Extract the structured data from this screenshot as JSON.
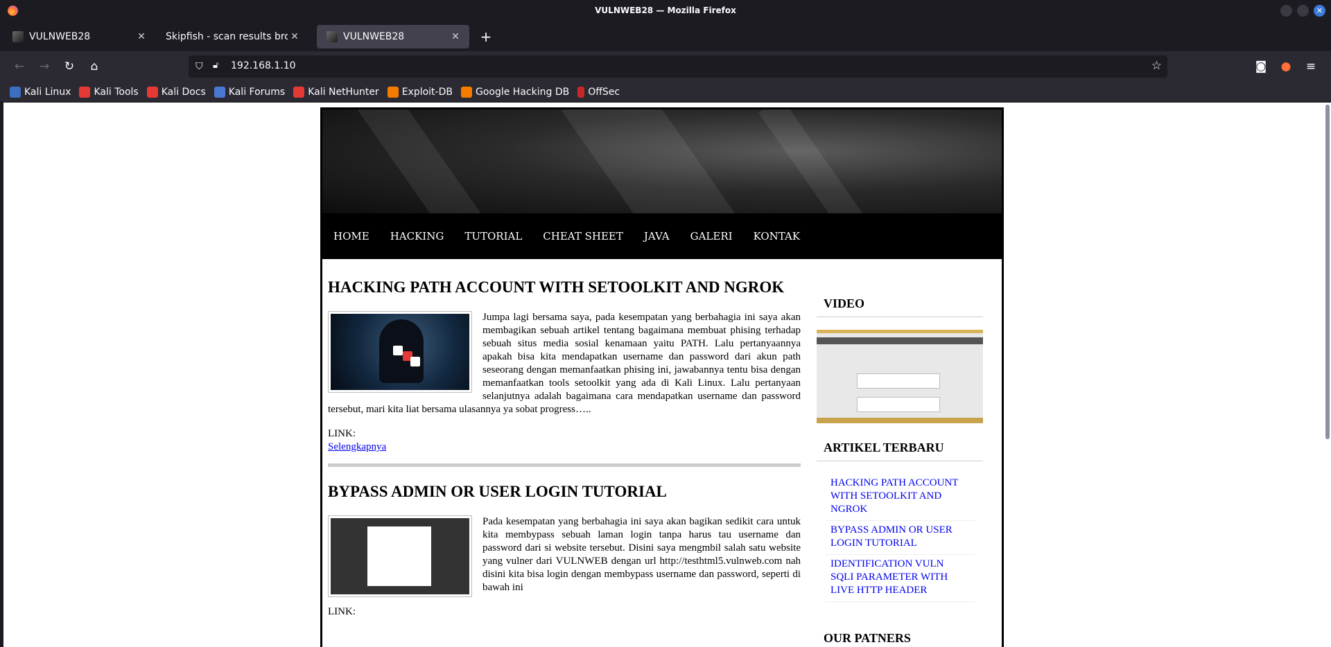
{
  "window": {
    "title": "VULNWEB28 — Mozilla Firefox"
  },
  "tabs": [
    {
      "label": "VULNWEB28",
      "active": false
    },
    {
      "label": "Skipfish - scan results browse",
      "active": false
    },
    {
      "label": "VULNWEB28",
      "active": true
    }
  ],
  "navbar": {
    "url": "192.168.1.10"
  },
  "bookmarks": [
    {
      "label": "Kali Linux",
      "icon": "kali-dragon-icon"
    },
    {
      "label": "Kali Tools",
      "icon": "kali-tools-icon"
    },
    {
      "label": "Kali Docs",
      "icon": "kali-docs-icon"
    },
    {
      "label": "Kali Forums",
      "icon": "kali-forums-icon"
    },
    {
      "label": "Kali NetHunter",
      "icon": "kali-nethunter-icon"
    },
    {
      "label": "Exploit-DB",
      "icon": "exploit-db-icon"
    },
    {
      "label": "Google Hacking DB",
      "icon": "ghdb-icon"
    },
    {
      "label": "OffSec",
      "icon": "offsec-icon"
    }
  ],
  "site": {
    "menu": [
      "HOME",
      "HACKING",
      "TUTORIAL",
      "CHEAT SHEET",
      "JAVA",
      "GALERI",
      "KONTAK"
    ],
    "posts": [
      {
        "title": "HACKING PATH ACCOUNT WITH SETOOLKIT AND NGROK",
        "body": "Jumpa lagi bersama saya, pada kesempatan yang berbahagia ini saya akan membagikan sebuah artikel tentang bagaimana membuat phising terhadap sebuah situs media sosial kenamaan yaitu PATH. Lalu pertanyaannya apakah bisa kita mendapatkan username dan password dari akun path seseorang dengan memanfaatkan phising ini, jawabannya tentu bisa dengan memanfaatkan tools setoolkit yang ada di Kali Linux. Lalu pertanyaan selanjutnya adalah bagaimana cara mendapatkan username dan password tersebut, mari kita liat bersama ulasannya ya sobat progress…..",
        "link_label": "LINK:",
        "link_text": "Selengkapnya"
      },
      {
        "title": "BYPASS ADMIN OR USER LOGIN TUTORIAL",
        "body": "Pada kesempatan yang berbahagia ini saya akan bagikan sedikit cara untuk kita membypass sebuah laman login tanpa harus tau username dan password dari si website tersebut. Disini saya mengmbil salah satu website yang vulner dari VULNWEB dengan url http://testhtml5.vulnweb.com nah disini kita bisa login dengan membypass username dan password, seperti di bawah ini",
        "link_label": "LINK:"
      }
    ],
    "sidebar": {
      "video_heading": "VIDEO",
      "articles_heading": "ARTIKEL TERBARU",
      "articles": [
        "HACKING PATH ACCOUNT WITH SETOOLKIT AND NGROK",
        "BYPASS ADMIN OR USER LOGIN TUTORIAL",
        "IDENTIFICATION VULN SQLI PARAMETER WITH LIVE HTTP HEADER"
      ],
      "partners_heading": "OUR PATNERS"
    }
  }
}
